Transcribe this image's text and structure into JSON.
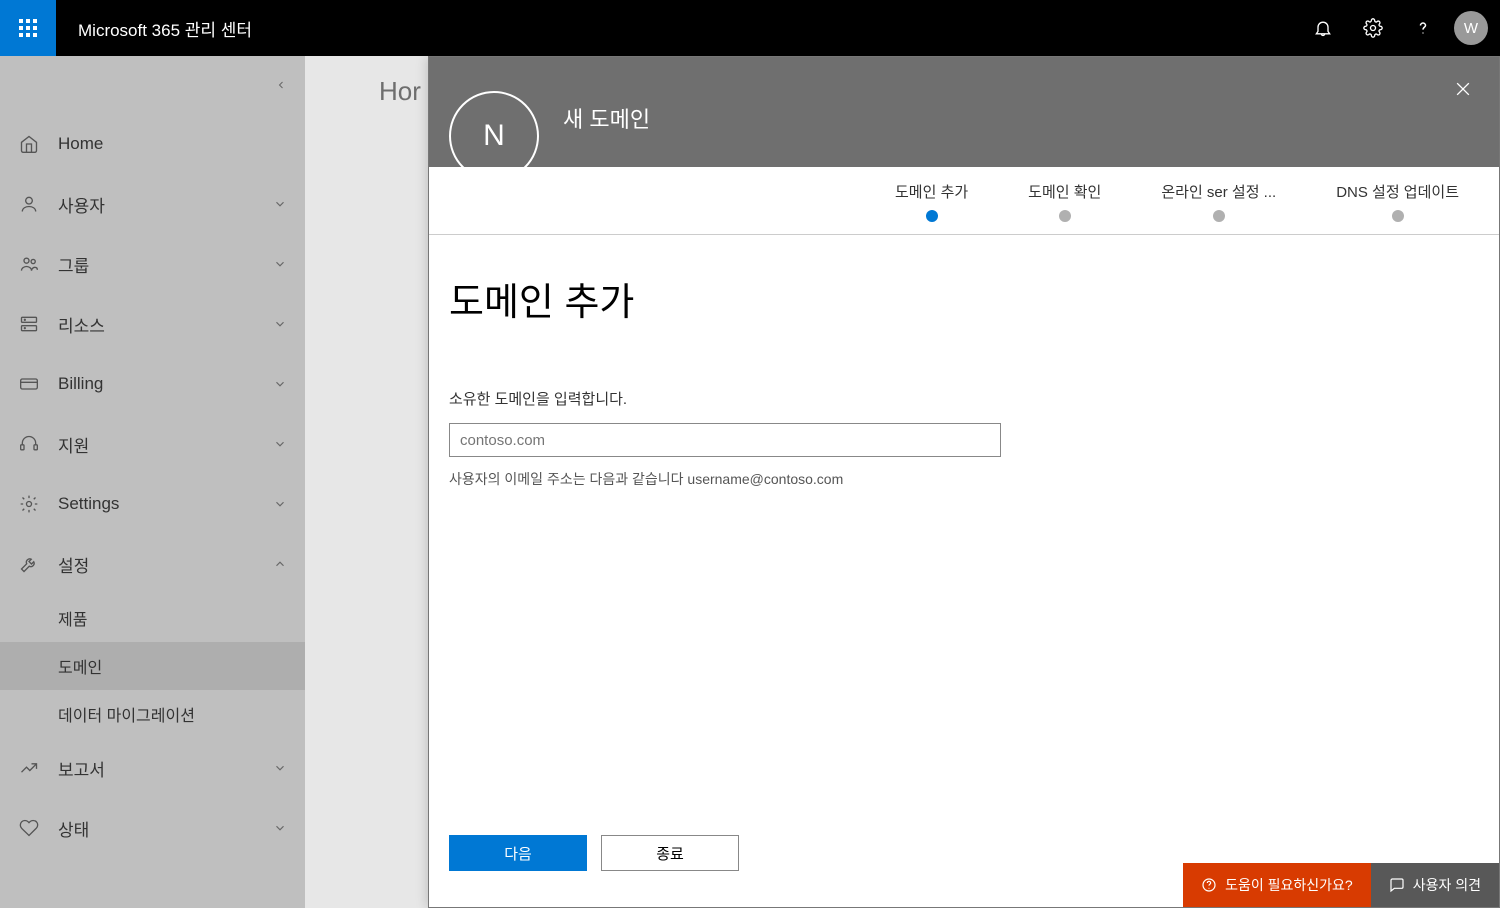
{
  "header": {
    "title": "Microsoft 365 관리 센터",
    "avatar_initial": "W"
  },
  "sidebar": {
    "items": [
      {
        "label": "Home",
        "icon": "home-icon",
        "expandable": false
      },
      {
        "label": "사용자",
        "icon": "user-icon",
        "expandable": true,
        "expanded": false
      },
      {
        "label": "그룹",
        "icon": "group-icon",
        "expandable": true,
        "expanded": false
      },
      {
        "label": "리소스",
        "icon": "resource-icon",
        "expandable": true,
        "expanded": false
      },
      {
        "label": "Billing",
        "icon": "billing-icon",
        "expandable": true,
        "expanded": false
      },
      {
        "label": "지원",
        "icon": "support-icon",
        "expandable": true,
        "expanded": false
      },
      {
        "label": "Settings",
        "icon": "settings-gear-icon",
        "expandable": true,
        "expanded": false
      },
      {
        "label": "설정",
        "icon": "wrench-icon",
        "expandable": true,
        "expanded": true,
        "sub": [
          {
            "label": "제품"
          },
          {
            "label": "도메인",
            "active": true
          },
          {
            "label": "데이터 마이그레이션"
          }
        ]
      },
      {
        "label": "보고서",
        "icon": "report-icon",
        "expandable": true,
        "expanded": false
      },
      {
        "label": "상태",
        "icon": "health-icon",
        "expandable": true,
        "expanded": false
      }
    ]
  },
  "breadcrumb": {
    "label": "Hor"
  },
  "panel": {
    "title": "새 도메인",
    "avatar_initial": "N",
    "steps": [
      {
        "label": "도메인 추가",
        "active": true
      },
      {
        "label": "도메인 확인",
        "active": false
      },
      {
        "label": "온라인 ser 설정 ...",
        "active": false
      },
      {
        "label": "DNS 설정 업데이트",
        "active": false
      }
    ],
    "heading": "도메인 추가",
    "field_label": "소유한 도메인을 입력합니다.",
    "domain_placeholder": "contoso.com",
    "domain_value": "",
    "hint": "사용자의 이메일 주소는 다음과 같습니다 username@contoso.com",
    "buttons": {
      "next": "다음",
      "close": "종료"
    }
  },
  "bottom": {
    "help": "도움이 필요하신가요?",
    "feedback": "사용자 의견"
  }
}
